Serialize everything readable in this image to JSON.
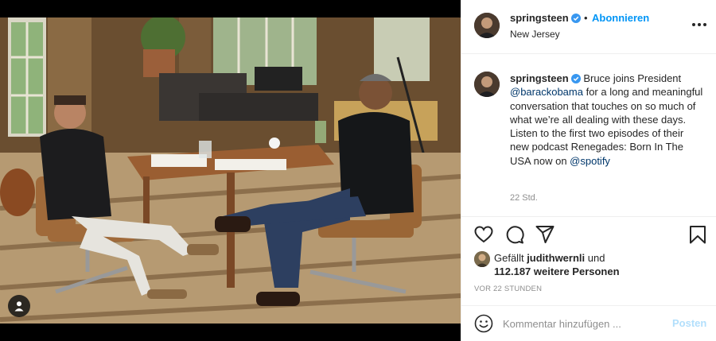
{
  "post": {
    "username": "springsteen",
    "follow_label": "Abonnieren",
    "follow_separator": "•",
    "location": "New Jersey",
    "caption": {
      "username": "springsteen",
      "text_before": "Bruce joins President ",
      "mention_1": "@barackobama",
      "text_middle": " for a long and meaningful conversation that touches on so much of what we’re all dealing with these days. Listen to the first two episodes of their new podcast Renegades: Born In The USA now on ",
      "mention_2": "@spotify",
      "time": "22 Std."
    },
    "likes": {
      "prefix": "Gefällt ",
      "liker": "judithwernli",
      "conjunction": " und",
      "count_text": "112.187 weitere Personen"
    },
    "date": "VOR 22 STUNDEN",
    "comment": {
      "placeholder": "Kommentar hinzufügen ...",
      "post_label": "Posten"
    }
  },
  "icons": {
    "verified": "verified-badge-icon",
    "more": "more-options-icon",
    "like": "heart-icon",
    "comment": "comment-bubble-icon",
    "share": "paper-plane-icon",
    "save": "bookmark-icon",
    "emoji": "smiley-icon",
    "tag": "user-tag-icon"
  },
  "colors": {
    "accent": "#0095f6",
    "mention": "#00376b",
    "verified": "#3897f0",
    "muted": "#8e8e8e",
    "post_disabled": "#b2dffc"
  }
}
